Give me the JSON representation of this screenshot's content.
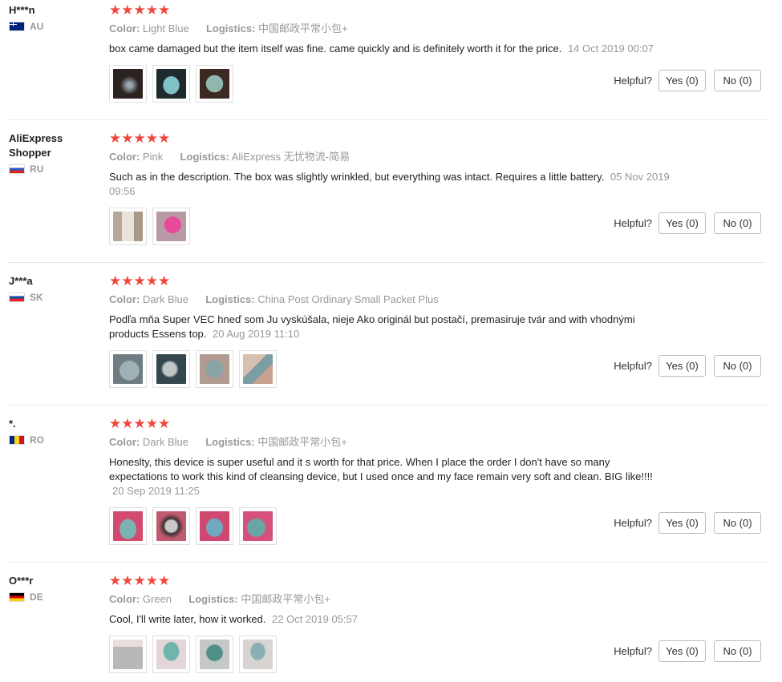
{
  "labels": {
    "color": "Color:",
    "logistics": "Logistics:",
    "helpful": "Helpful?"
  },
  "star_glyphs": "★★★★★",
  "reviews": [
    {
      "user": "H***n",
      "country_code": "AU",
      "flag": "flag-au",
      "rating": 5,
      "color_value": "Light Blue",
      "logistics_value": "中国邮政平常小包+",
      "text": "box came damaged but the item itself was fine. came quickly and is definitely worth it for the price.",
      "date": "14 Oct 2019 00:07",
      "photo_count": 3,
      "photo_colors": [
        "#2b2320",
        "#1e2a2c",
        "#3a2a22"
      ],
      "yes": "Yes (0)",
      "no": "No (0)"
    },
    {
      "user": "AliExpress Shopper",
      "country_code": "RU",
      "flag": "flag-ru",
      "rating": 5,
      "color_value": "Pink",
      "logistics_value": "AliExpress 无忧物流-简易",
      "text": "Such as in the description. The box was slightly wrinkled, but everything was intact. Requires a little battery.",
      "date": "05 Nov 2019 09:56",
      "photo_count": 2,
      "photo_colors": [
        "#c9b9a8",
        "#b89aa6"
      ],
      "yes": "Yes (0)",
      "no": "No (0)"
    },
    {
      "user": "J***a",
      "country_code": "SK",
      "flag": "flag-sk",
      "rating": 5,
      "color_value": "Dark Blue",
      "logistics_value": "China Post Ordinary Small Packet Plus",
      "text": "Podľa mňa Super VEC hneď som Ju vyskúšala, nieje Ako originál but postačí, premasiruje tvár and with vhodnými products Essens top.",
      "date": "20 Aug 2019 11:10",
      "photo_count": 4,
      "photo_colors": [
        "#7f8f95",
        "#5d6a70",
        "#9a8a80",
        "#b09080"
      ],
      "yes": "Yes (0)",
      "no": "No (0)"
    },
    {
      "user": "*.",
      "country_code": "RO",
      "flag": "flag-ro",
      "rating": 5,
      "color_value": "Dark Blue",
      "logistics_value": "中国邮政平常小包+",
      "text": "Honeslty, this device is super useful and it s worth for that price. When I place the order I don't have so many expectations to work this kind of cleansing device, but I used once and my face remain very soft and clean. BIG like!!!!",
      "date": "20 Sep 2019 11:25",
      "photo_count": 4,
      "photo_colors": [
        "#d24a6e",
        "#8a5a60",
        "#d04870",
        "#d5507a"
      ],
      "yes": "Yes (0)",
      "no": "No (0)"
    },
    {
      "user": "O***r",
      "country_code": "DE",
      "flag": "flag-de",
      "rating": 5,
      "color_value": "Green",
      "logistics_value": "中国邮政平常小包+",
      "text": "Cool, I'll write later, how it worked.",
      "date": "22 Oct 2019 05:57",
      "photo_count": 4,
      "photo_colors": [
        "#c8c8c8",
        "#cfd6d4",
        "#c4c9c6",
        "#d0d0d0"
      ],
      "yes": "Yes (0)",
      "no": "No (0)"
    }
  ]
}
